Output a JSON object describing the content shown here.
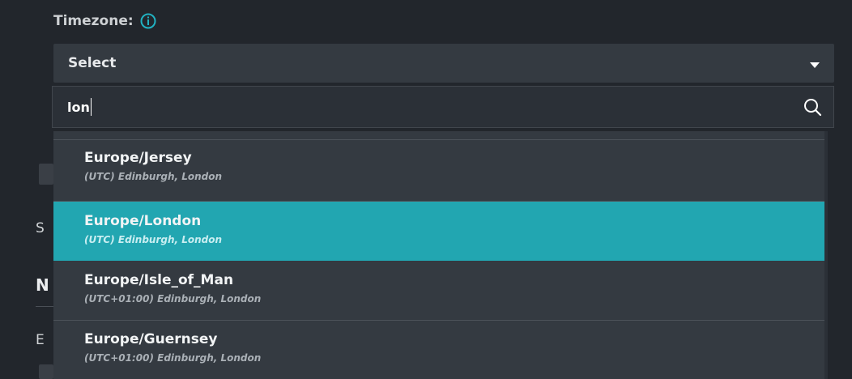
{
  "timezone_field": {
    "label": "Timezone:",
    "info_icon": "info-icon",
    "select": {
      "value": "Select",
      "caret_icon": "caret-down-icon"
    },
    "search": {
      "value": "lon",
      "search_icon": "search-icon"
    },
    "results": [
      {
        "title": "Europe/Jersey",
        "subtitle": "(UTC) Edinburgh, London",
        "selected": false
      },
      {
        "title": "Europe/London",
        "subtitle": "(UTC) Edinburgh, London",
        "selected": true
      },
      {
        "title": "Europe/Isle_of_Man",
        "subtitle": "(UTC+01:00) Edinburgh, London",
        "selected": false
      },
      {
        "title": "Europe/Guernsey",
        "subtitle": "(UTC+01:00) Edinburgh, London",
        "selected": false
      }
    ]
  },
  "background_fragments": {
    "frag_1": "S",
    "frag_2": "N",
    "frag_3": "E"
  },
  "colors": {
    "background": "#22262c",
    "field_bg": "#343a41",
    "accent_selected": "#22a6b1",
    "info_icon": "#21b2c2",
    "text_primary": "#e6e8ea",
    "text_secondary": "#aab0b6"
  }
}
